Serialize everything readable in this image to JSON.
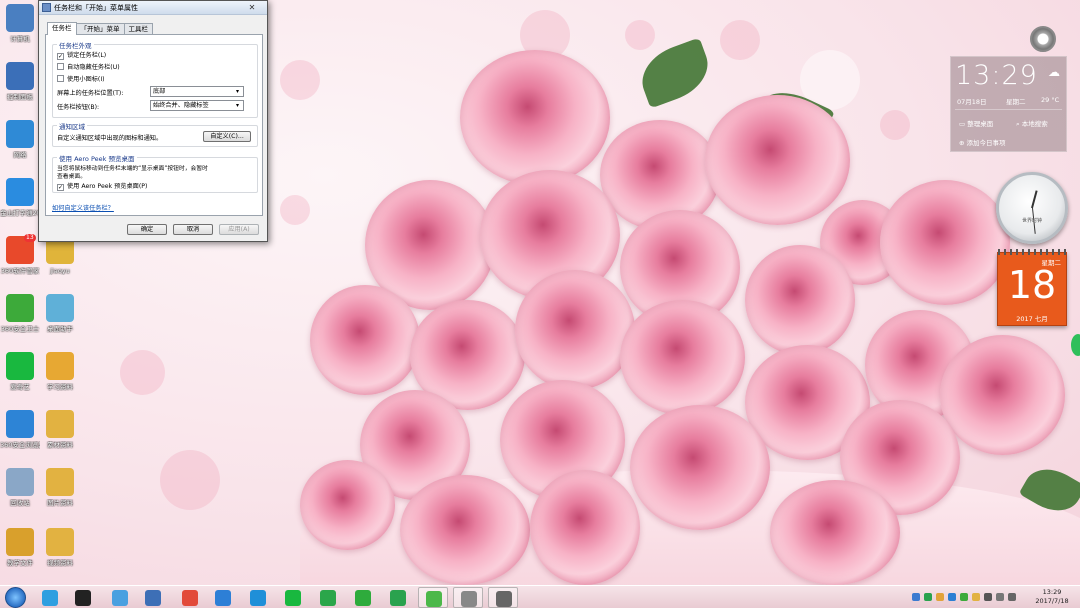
{
  "desktop_icons": [
    {
      "label": "计算机",
      "color": "#4a7fc1"
    },
    {
      "label": "控制面板",
      "color": "#3b6fb8"
    },
    {
      "label": "网络",
      "color": "#2f8ad6"
    },
    {
      "label": "金山打字通2016",
      "color": "#2a8ce0"
    },
    {
      "label": "360软件管家",
      "color": "#e8492b",
      "badge": "13"
    },
    {
      "label": "jiaoyu",
      "color": "#e0b43a"
    },
    {
      "label": "360安全卫士",
      "color": "#3daa3a"
    },
    {
      "label": "桌面助手",
      "color": "#5fb0d8"
    },
    {
      "label": "爱奇艺",
      "color": "#19b83f"
    },
    {
      "label": "学习资料",
      "color": "#e7a833"
    },
    {
      "label": "360安全浏览器",
      "color": "#2d84d6"
    },
    {
      "label": "素材资料",
      "color": "#e2b241"
    },
    {
      "label": "回收站",
      "color": "#8aa7c7"
    },
    {
      "label": "图片资料",
      "color": "#e2b241"
    },
    {
      "label": "教学文件",
      "color": "#d9a02c"
    },
    {
      "label": "视频资料",
      "color": "#e2b241"
    }
  ],
  "dialog": {
    "title": "任务栏和「开始」菜单属性",
    "close": "✕",
    "tabs": [
      "任务栏",
      "「开始」菜单",
      "工具栏"
    ],
    "appearance": {
      "title": "任务栏外观",
      "lock": "锁定任务栏(L)",
      "autohide": "自动隐藏任务栏(U)",
      "small_icons": "使用小图标(I)",
      "lock_checked": "✓",
      "position_label": "屏幕上的任务栏位置(T):",
      "position_value": "底部",
      "buttons_label": "任务栏按钮(B):",
      "buttons_value": "始终合并、隐藏标签"
    },
    "notification": {
      "title": "通知区域",
      "text": "自定义通知区域中出现的图标和通知。",
      "customize": "自定义(C)..."
    },
    "aero": {
      "title": "使用 Aero Peek 预览桌面",
      "text1": "当您将鼠标移动到任务栏末端的“显示桌面”按钮时，会暂时",
      "text2": "查看桌面。",
      "checkbox": "使用 Aero Peek 预览桌面(P)",
      "checked": "✓"
    },
    "help_link": "如何自定义该任务栏？",
    "ok": "确定",
    "cancel": "取消",
    "apply": "应用(A)",
    "arrow": "▾"
  },
  "weather": {
    "time": "13:29",
    "cloud": "☁",
    "date": "07月18日",
    "weekday": "星期二",
    "temp": "29 °C",
    "item1": "整理桌面",
    "item2": "本地搜索",
    "item3": "添加今日事项"
  },
  "calendar": {
    "weekday": "星期二",
    "day": "18",
    "yearmonth": "2017 七月"
  },
  "clock_gadget": {
    "brand": "世界时钟"
  },
  "taskbar": {
    "apps": [
      {
        "name": "ie",
        "color": "#2f9fe0"
      },
      {
        "name": "r-app",
        "color": "#222"
      },
      {
        "name": "360",
        "color": "#4aa0e0"
      },
      {
        "name": "eyes",
        "color": "#3d6fb6"
      },
      {
        "name": "browser",
        "color": "#e24a3a"
      },
      {
        "name": "g-app",
        "color": "#2d7fd6"
      },
      {
        "name": "k-app",
        "color": "#1f8fd8"
      },
      {
        "name": "iqiyi",
        "color": "#19b83f"
      },
      {
        "name": "nav",
        "color": "#2ba64a"
      },
      {
        "name": "s-app",
        "color": "#2eab3c"
      },
      {
        "name": "wps",
        "color": "#2aa24e"
      },
      {
        "name": "clover",
        "color": "#4cb84a"
      },
      {
        "name": "doc",
        "color": "#888"
      },
      {
        "name": "window",
        "color": "#666"
      }
    ],
    "time": "13:29",
    "date": "2017/7/18"
  }
}
